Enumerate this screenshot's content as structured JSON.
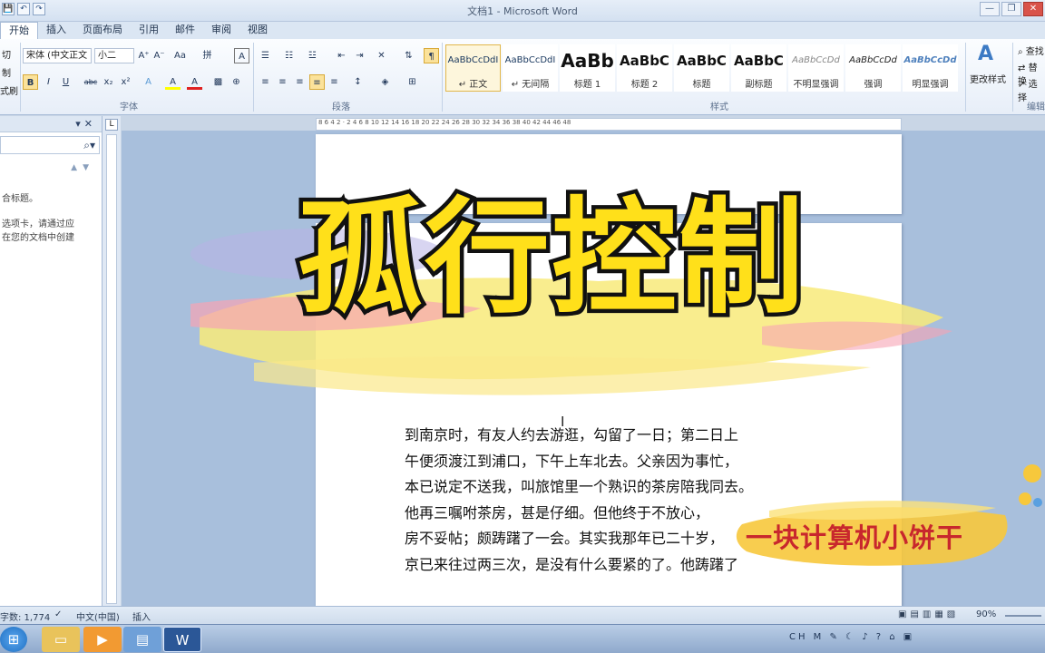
{
  "window": {
    "title": "文档1 - Microsoft Word",
    "quick_access": [
      "💾",
      "↶",
      "↷"
    ],
    "controls": [
      "—",
      "❐",
      "✕"
    ]
  },
  "tabs": [
    "开始",
    "插入",
    "页面布局",
    "引用",
    "邮件",
    "审阅",
    "视图"
  ],
  "ribbon": {
    "clipboard": {
      "cut_label": "切",
      "copy_label": "制",
      "painter_label": "式刷"
    },
    "font": {
      "font_name": "宋体 (中文正文",
      "font_size": "小二",
      "group_label": "字体",
      "buttons": [
        "B",
        "I",
        "U",
        "abc",
        "x₂",
        "x²",
        "A",
        "A",
        "A"
      ],
      "size_buttons": [
        "A⁺",
        "A⁻",
        "Aa",
        "拼",
        "A"
      ]
    },
    "paragraph": {
      "group_label": "段落",
      "buttons": [
        "≡",
        "≡",
        "≡",
        "≡",
        "≡",
        "↕",
        "⊞"
      ]
    },
    "styles": {
      "group_label": "样式",
      "items": [
        {
          "sample": "AaBbCcDdI",
          "name": "↵ 正文"
        },
        {
          "sample": "AaBbCcDdI",
          "name": "↵ 无间隔"
        },
        {
          "sample": "AaBb",
          "name": "标题 1"
        },
        {
          "sample": "AaBbC",
          "name": "标题 2"
        },
        {
          "sample": "AaBbC",
          "name": "标题"
        },
        {
          "sample": "AaBbC",
          "name": "副标题"
        },
        {
          "sample": "AaBbCcDd",
          "name": "不明显强调"
        },
        {
          "sample": "AaBbCcDd",
          "name": "强调"
        },
        {
          "sample": "AaBbCcDd",
          "name": "明显强调"
        }
      ],
      "change_styles": "更改样式"
    },
    "editing": {
      "group_label": "编辑",
      "find": "查找",
      "replace": "替换",
      "select": "选择"
    }
  },
  "nav_pane": {
    "text_line1": "合标题。",
    "text_line2": "选项卡，请通过应",
    "text_line3": "在您的文档中创建"
  },
  "ruler_corner": "L",
  "ruler_text": "8 6 4 2 · 2 4 6 8 10 12 14 16 18 20 22 24 26 28 30 32 34 36 38 40 42 44 46 48",
  "overlay": {
    "title": "孤行控制",
    "watermark": "一块计算机小饼干"
  },
  "document": {
    "lines": [
      "到南京时，有友人约去游逛，勾留了一日；第二日上",
      "午便须渡江到浦口，下午上车北去。父亲因为事忙，",
      "本已说定不送我，叫旅馆里一个熟识的茶房陪我同去。",
      "他再三嘱咐茶房，甚是仔细。但他终于不放心，",
      "房不妥帖；颇踌躇了一会。其实我那年已二十岁，",
      "京已来往过两三次，是没有什么要紧的了。他踌躇了"
    ]
  },
  "status_bar": {
    "word_count": "字数: 1,774",
    "language": "中文(中国)",
    "mode": "插入",
    "zoom": "90%"
  },
  "taskbar": {
    "tray_text": "CH M ✎ ☾ ♪ ? ⌂ ▣",
    "colors": {
      "word": "#2b5797",
      "start": "#1e6fc2"
    }
  }
}
